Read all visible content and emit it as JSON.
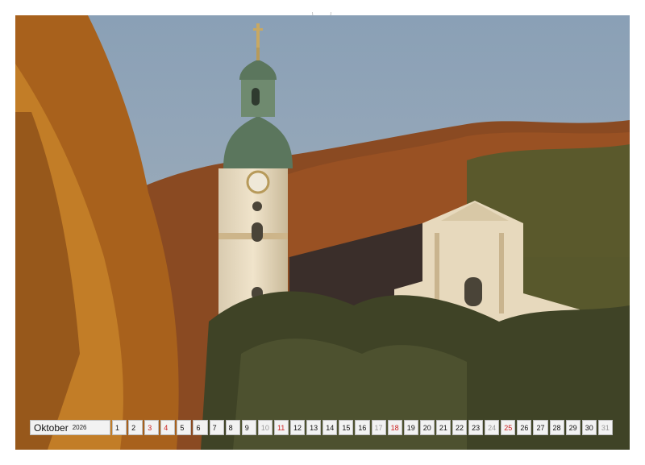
{
  "calendar": {
    "month": "Oktober",
    "year": "2026",
    "days": [
      {
        "n": "1",
        "kind": "weekday"
      },
      {
        "n": "2",
        "kind": "weekday"
      },
      {
        "n": "3",
        "kind": "holiday"
      },
      {
        "n": "4",
        "kind": "holiday"
      },
      {
        "n": "5",
        "kind": "weekday"
      },
      {
        "n": "6",
        "kind": "weekday"
      },
      {
        "n": "7",
        "kind": "weekday"
      },
      {
        "n": "8",
        "kind": "weekday"
      },
      {
        "n": "9",
        "kind": "weekday"
      },
      {
        "n": "10",
        "kind": "weekend"
      },
      {
        "n": "11",
        "kind": "holiday"
      },
      {
        "n": "12",
        "kind": "weekday"
      },
      {
        "n": "13",
        "kind": "weekday"
      },
      {
        "n": "14",
        "kind": "weekday"
      },
      {
        "n": "15",
        "kind": "weekday"
      },
      {
        "n": "16",
        "kind": "weekday"
      },
      {
        "n": "17",
        "kind": "weekend"
      },
      {
        "n": "18",
        "kind": "holiday"
      },
      {
        "n": "19",
        "kind": "weekday"
      },
      {
        "n": "20",
        "kind": "weekday"
      },
      {
        "n": "21",
        "kind": "weekday"
      },
      {
        "n": "22",
        "kind": "weekday"
      },
      {
        "n": "23",
        "kind": "weekday"
      },
      {
        "n": "24",
        "kind": "weekend"
      },
      {
        "n": "25",
        "kind": "holiday"
      },
      {
        "n": "26",
        "kind": "weekday"
      },
      {
        "n": "27",
        "kind": "weekday"
      },
      {
        "n": "28",
        "kind": "weekday"
      },
      {
        "n": "29",
        "kind": "weekday"
      },
      {
        "n": "30",
        "kind": "weekday"
      },
      {
        "n": "31",
        "kind": "weekend"
      }
    ]
  },
  "colors": {
    "sky": "#7e95ad",
    "foliage_orange": "#b8671e",
    "foliage_dark": "#3d3a24",
    "church_facade": "#e9dcc2",
    "dome_green": "#5f7a62",
    "holiday_red": "#cc2222"
  },
  "photo": {
    "subject": "baroque-church-autumn"
  }
}
